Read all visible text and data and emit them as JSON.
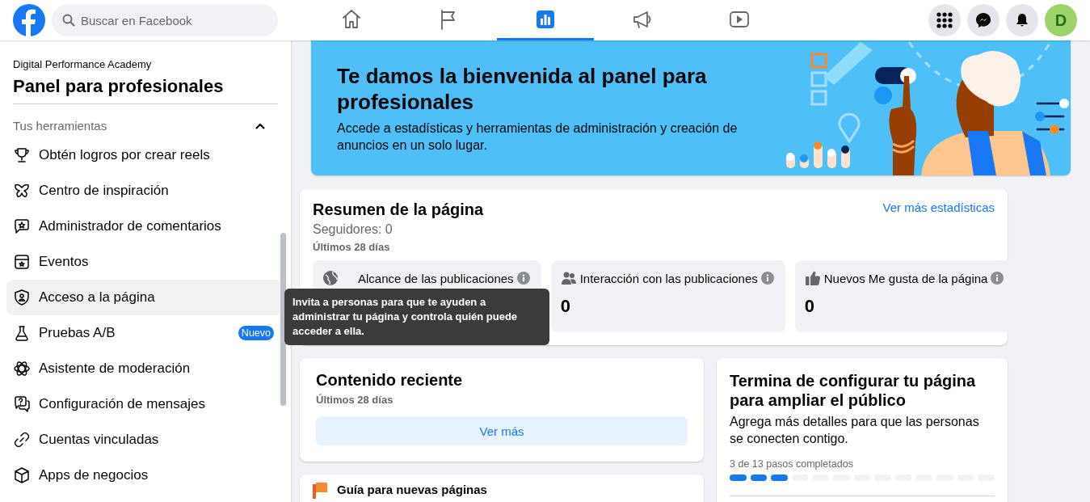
{
  "topbar": {
    "search": {
      "placeholder": "Buscar en Facebook"
    },
    "nav_tabs": [
      {
        "selected": false
      },
      {
        "selected": false
      },
      {
        "selected": true
      },
      {
        "selected": false
      },
      {
        "selected": false
      }
    ],
    "avatar": {
      "initial": "D"
    }
  },
  "sidebar": {
    "page_name": "Digital Performance Academy",
    "title": "Panel para profesionales",
    "section": {
      "title": "Tus herramientas",
      "expanded": true
    },
    "items": [
      {
        "label": "Obtén logros por crear reels",
        "highlighted": false
      },
      {
        "label": "Centro de inspiración",
        "highlighted": false
      },
      {
        "label": "Administrador de comentarios",
        "highlighted": false
      },
      {
        "label": "Eventos",
        "highlighted": false
      },
      {
        "label": "Acceso a la página",
        "highlighted": true
      },
      {
        "label": "Pruebas A/B",
        "highlighted": false,
        "badge": "Nuevo"
      },
      {
        "label": "Asistente de moderación",
        "highlighted": false
      },
      {
        "label": "Configuración de mensajes",
        "highlighted": false
      },
      {
        "label": "Cuentas vinculadas",
        "highlighted": false
      },
      {
        "label": "Apps de negocios",
        "highlighted": false
      }
    ]
  },
  "banner": {
    "title": "Te damos la bienvenida al panel para profesionales",
    "description": "Accede a estadísticas y herramientas de administración y creación de anuncios en un solo lugar."
  },
  "summary": {
    "title": "Resumen de la página",
    "followers": "Seguidores: 0",
    "period": "Últimos 28 días",
    "link": "Ver más estadísticas",
    "stats": [
      {
        "label": "Alcance de las publicaciones"
      },
      {
        "label": "Interacción con las publicaciones",
        "value": "0"
      },
      {
        "label": "Nuevos Me gusta de la página",
        "value": "0"
      }
    ]
  },
  "tooltip": {
    "text": "Invita a personas para que te ayuden a administrar tu página y controla quién puede acceder a ella."
  },
  "recent": {
    "title": "Contenido reciente",
    "period": "Últimos 28 días",
    "button": "Ver más"
  },
  "setup": {
    "title": "Termina de configurar tu página para ampliar el público",
    "description": "Agrega más detalles para que las personas se conecten contigo.",
    "progress_label": "3 de 13 pasos completados",
    "steps": [
      {
        "done": true
      },
      {
        "done": true
      },
      {
        "done": true
      },
      {
        "done": false
      },
      {
        "done": false
      },
      {
        "done": false
      },
      {
        "done": false
      },
      {
        "done": false
      },
      {
        "done": false
      },
      {
        "done": false
      },
      {
        "done": false
      },
      {
        "done": false
      },
      {
        "done": false
      }
    ]
  },
  "guide": {
    "title": "Guía para nuevas páginas"
  }
}
